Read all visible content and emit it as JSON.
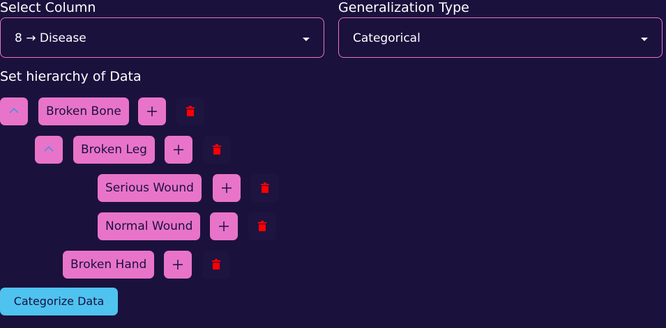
{
  "select_column": {
    "label": "Select Column",
    "value": "8 → Disease"
  },
  "generalization_type": {
    "label": "Generalization Type",
    "value": "Categorical"
  },
  "hierarchy": {
    "label": "Set hierarchy of Data",
    "nodes": [
      {
        "label": "Broken Bone",
        "depth": 0,
        "collapsible": true
      },
      {
        "label": "Broken Leg",
        "depth": 1,
        "collapsible": true
      },
      {
        "label": "Serious Wound",
        "depth": 2,
        "collapsible": false
      },
      {
        "label": "Normal Wound",
        "depth": 2,
        "collapsible": false
      },
      {
        "label": "Broken Hand",
        "depth": 1,
        "collapsible": false
      }
    ]
  },
  "categorize_button": {
    "label": "Categorize Data"
  },
  "colors": {
    "background": "#1b113d",
    "accent_pink": "#e874c9",
    "accent_blue": "#4fc3f0",
    "delete_red": "#ff0000",
    "chevron_blue": "#4d8fe0"
  },
  "icons": {
    "dropdown": "caret-down-icon",
    "collapse": "chevron-up-icon",
    "add": "plus-icon",
    "delete": "trash-icon"
  }
}
